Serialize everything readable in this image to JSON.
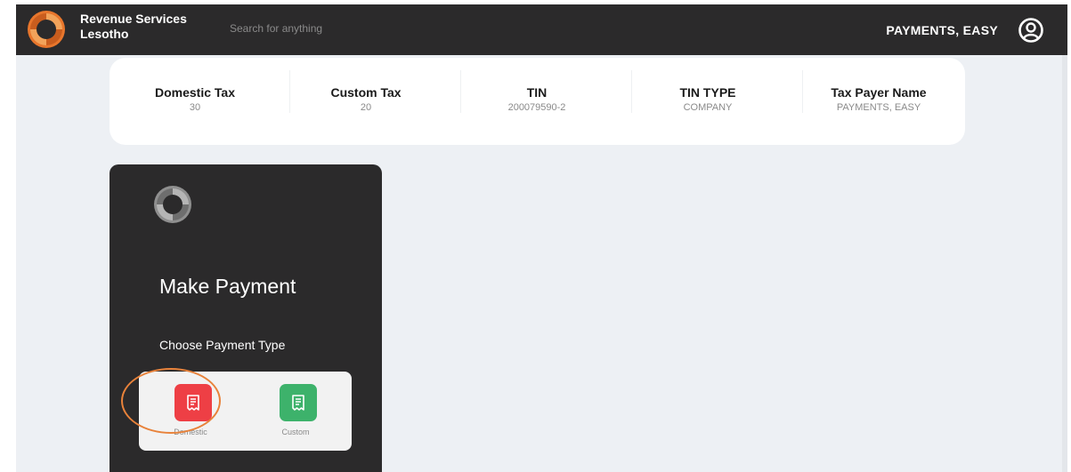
{
  "header": {
    "brand_line1": "Revenue Services",
    "brand_line2": "Lesotho",
    "search_placeholder": "Search for anything",
    "user_name": "PAYMENTS, EASY",
    "logo_icon": "rsl-logo-icon",
    "user_icon": "user-circle-icon"
  },
  "summary": [
    {
      "label": "Domestic Tax",
      "value": "30"
    },
    {
      "label": "Custom Tax",
      "value": "20"
    },
    {
      "label": "TIN",
      "value": "200079590-2"
    },
    {
      "label": "TIN TYPE",
      "value": "COMPANY"
    },
    {
      "label": "Tax Payer Name",
      "value": "PAYMENTS, EASY"
    }
  ],
  "payment": {
    "title": "Make Payment",
    "subtitle": "Choose Payment Type",
    "options": [
      {
        "label": "Domestic",
        "icon": "receipt-icon",
        "color": "#ee3f45"
      },
      {
        "label": "Custom",
        "icon": "receipt-icon",
        "color": "#3db26b"
      }
    ]
  },
  "colors": {
    "topbar": "#2b2a2b",
    "background": "#edf0f4",
    "accent_orange": "#e8823a",
    "domestic_red": "#ee3f45",
    "custom_green": "#3db26b"
  }
}
